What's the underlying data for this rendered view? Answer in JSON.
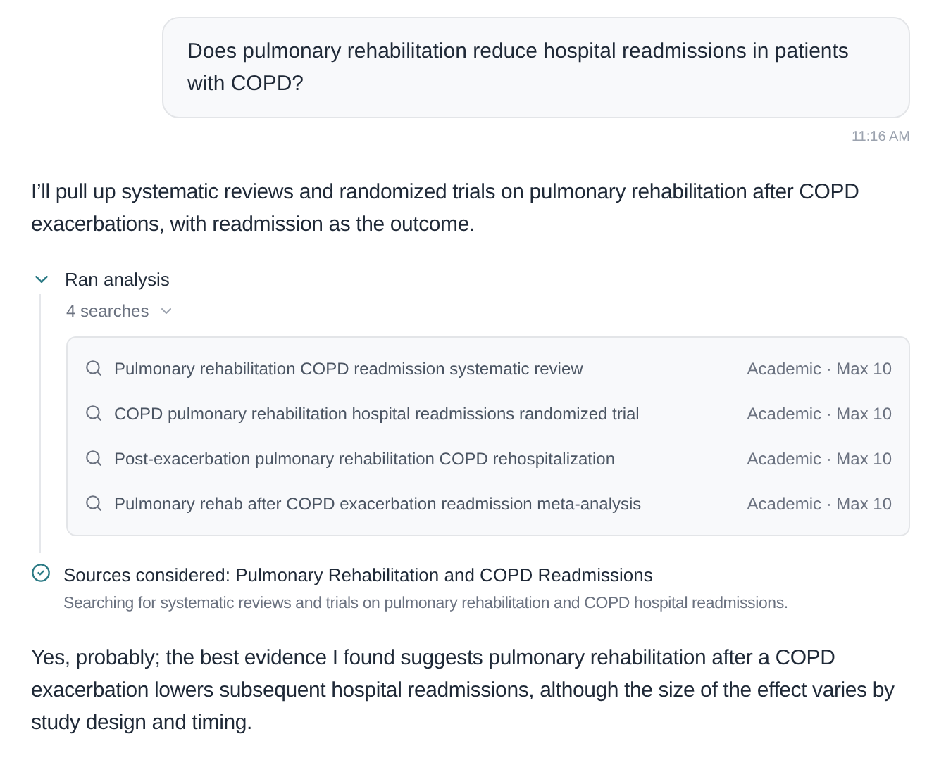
{
  "user_message": {
    "text": "Does pulmonary rehabilitation reduce hospital readmissions in patients with COPD?",
    "time": "11:16 AM"
  },
  "intro": "I’ll pull up systematic reviews and randomized trials on pulmonary rehabilitation after COPD exacerbations, with readmission as the outcome.",
  "analysis": {
    "title": "Ran analysis",
    "expanded": true,
    "summary": "4 searches",
    "searches": [
      {
        "query": "Pulmonary rehabilitation COPD readmission systematic review",
        "meta": "Academic · Max 10"
      },
      {
        "query": "COPD pulmonary rehabilitation hospital readmissions randomized trial",
        "meta": "Academic · Max 10"
      },
      {
        "query": "Post-exacerbation pulmonary rehabilitation COPD rehospitalization",
        "meta": "Academic · Max 10"
      },
      {
        "query": "Pulmonary rehab after COPD exacerbation readmission meta-analysis",
        "meta": "Academic · Max 10"
      }
    ]
  },
  "sources": {
    "title": "Sources considered: Pulmonary Rehabilitation and COPD Readmissions",
    "done": true,
    "description": "Searching for systematic reviews and trials on pulmonary rehabilitation and COPD hospital readmissions."
  },
  "answer": "Yes, probably; the best evidence I found suggests pulmonary rehabilitation after a COPD exacerbation lowers subsequent hospital readmissions, although the size of the effect varies by study design and timing."
}
